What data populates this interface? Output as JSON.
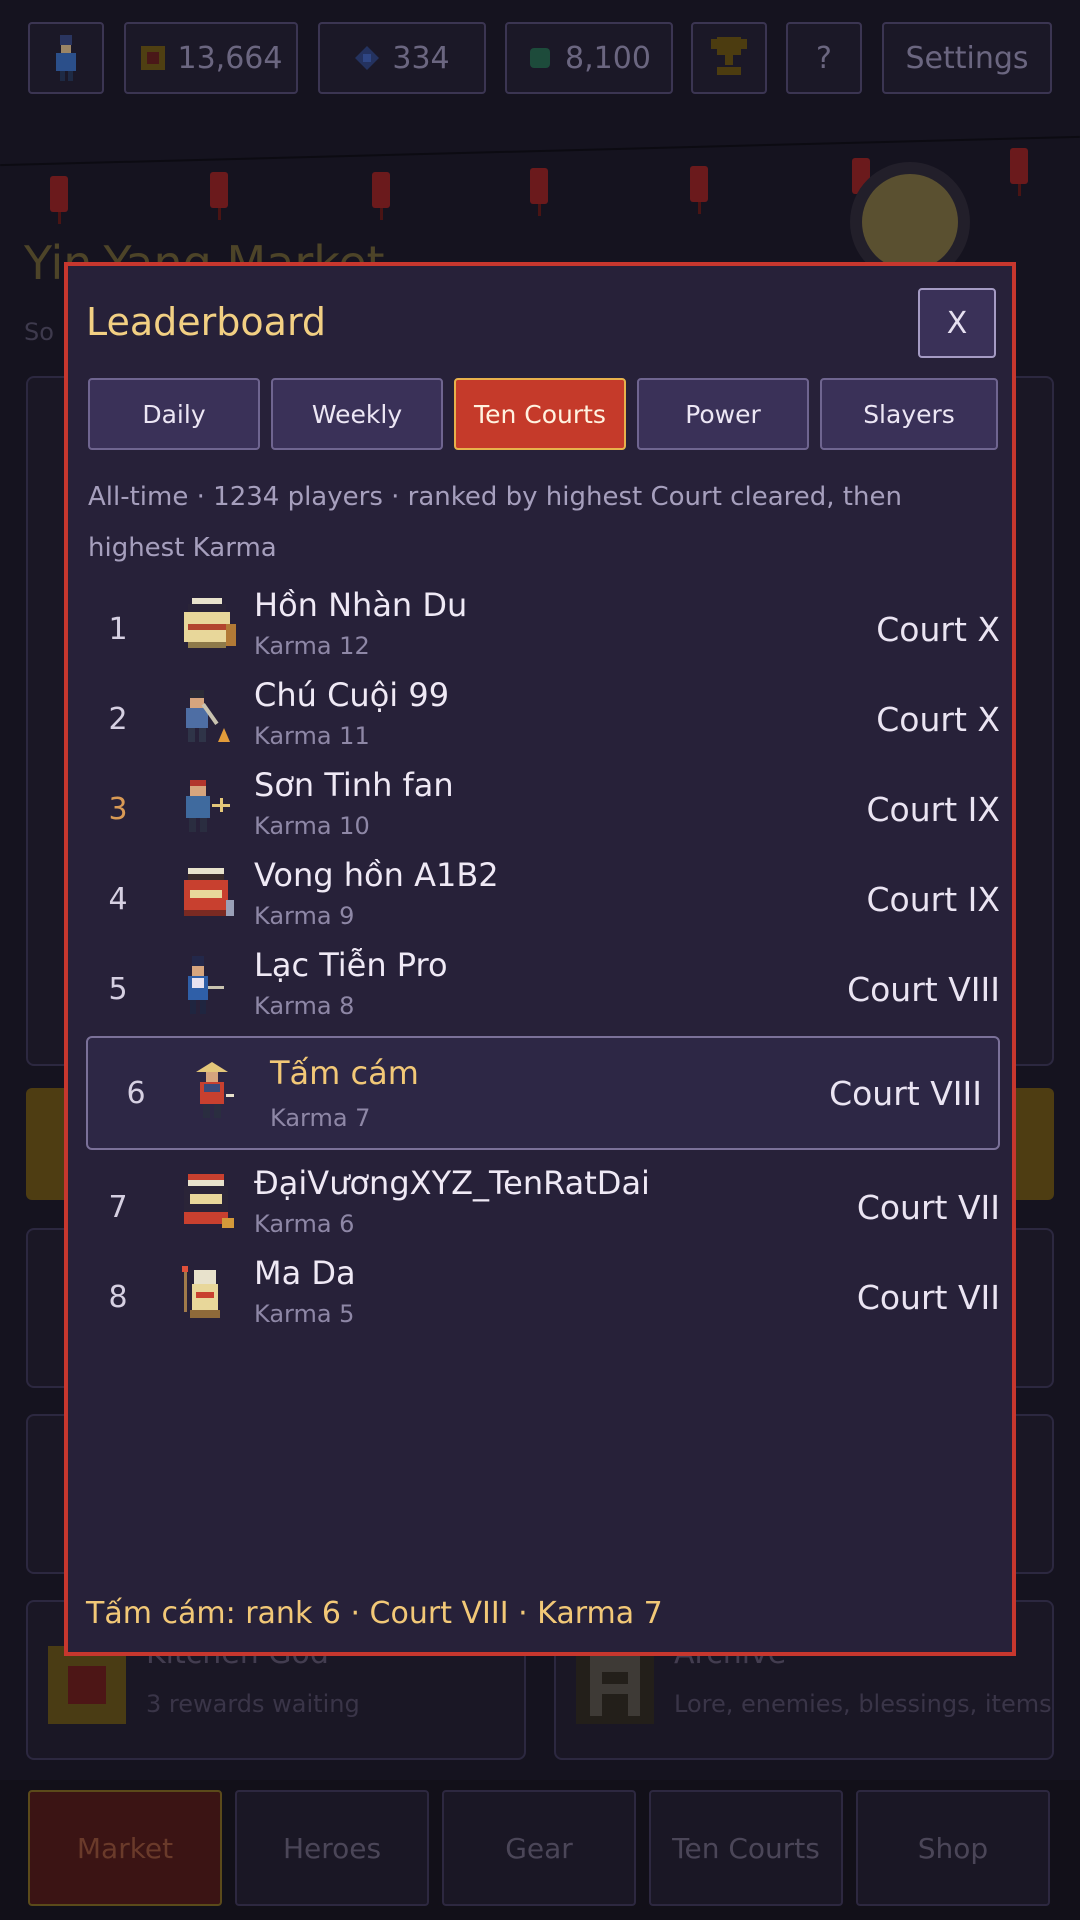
{
  "header": {
    "currencies": [
      {
        "name": "gold-coin-icon",
        "value": "13,664",
        "color": "#e0b33a"
      },
      {
        "name": "spirit-gem-icon",
        "value": "334",
        "color": "#4a7bd8"
      },
      {
        "name": "jade-icon",
        "value": "8,100",
        "color": "#3aa37a"
      }
    ],
    "help_label": "?",
    "settings_label": "Settings"
  },
  "background": {
    "title": "Yin-Yang Market",
    "subtitle": "So",
    "cards": [
      {
        "title": "Kitchen God",
        "subtitle": "3 rewards waiting"
      },
      {
        "title": "Archive",
        "subtitle": "Lore, enemies, blessings, items"
      }
    ],
    "nav": [
      "Market",
      "Heroes",
      "Gear",
      "Ten Courts",
      "Shop"
    ],
    "nav_active": "Market"
  },
  "modal": {
    "title": "Leaderboard",
    "close_label": "X",
    "tabs": [
      "Daily",
      "Weekly",
      "Ten Courts",
      "Power",
      "Slayers"
    ],
    "active_tab": "Ten Courts",
    "description": "All-time · 1234 players · ranked by highest Court cleared, then highest Karma",
    "rows": [
      {
        "rank": "1",
        "name": "Hồn Nhàn Du",
        "karma": "Karma 12",
        "court": "Court X",
        "avatar": "spirit-shrine-icon"
      },
      {
        "rank": "2",
        "name": "Chú Cuội 99",
        "karma": "Karma 11",
        "court": "Court X",
        "avatar": "woodcutter-icon"
      },
      {
        "rank": "3",
        "name": "Sơn Tinh fan",
        "karma": "Karma 10",
        "court": "Court IX",
        "avatar": "mountain-god-icon"
      },
      {
        "rank": "4",
        "name": "Vong hồn A1B2",
        "karma": "Karma 9",
        "court": "Court IX",
        "avatar": "wandering-soul-icon"
      },
      {
        "rank": "5",
        "name": "Lạc Tiễn Pro",
        "karma": "Karma 8",
        "court": "Court VIII",
        "avatar": "archer-icon"
      },
      {
        "rank": "6",
        "name": "Tấm cám",
        "karma": "Karma 7",
        "court": "Court VIII",
        "avatar": "farmer-girl-icon"
      },
      {
        "rank": "7",
        "name": "ĐạiVươngXYZ_TenRatDai",
        "karma": "Karma 6",
        "court": "Court VII",
        "avatar": "demon-king-icon"
      },
      {
        "rank": "8",
        "name": "Ma Da",
        "karma": "Karma 5",
        "court": "Court VII",
        "avatar": "water-ghost-icon"
      }
    ],
    "footer": "Tấm cám: rank 6 · Court VIII · Karma 7"
  }
}
